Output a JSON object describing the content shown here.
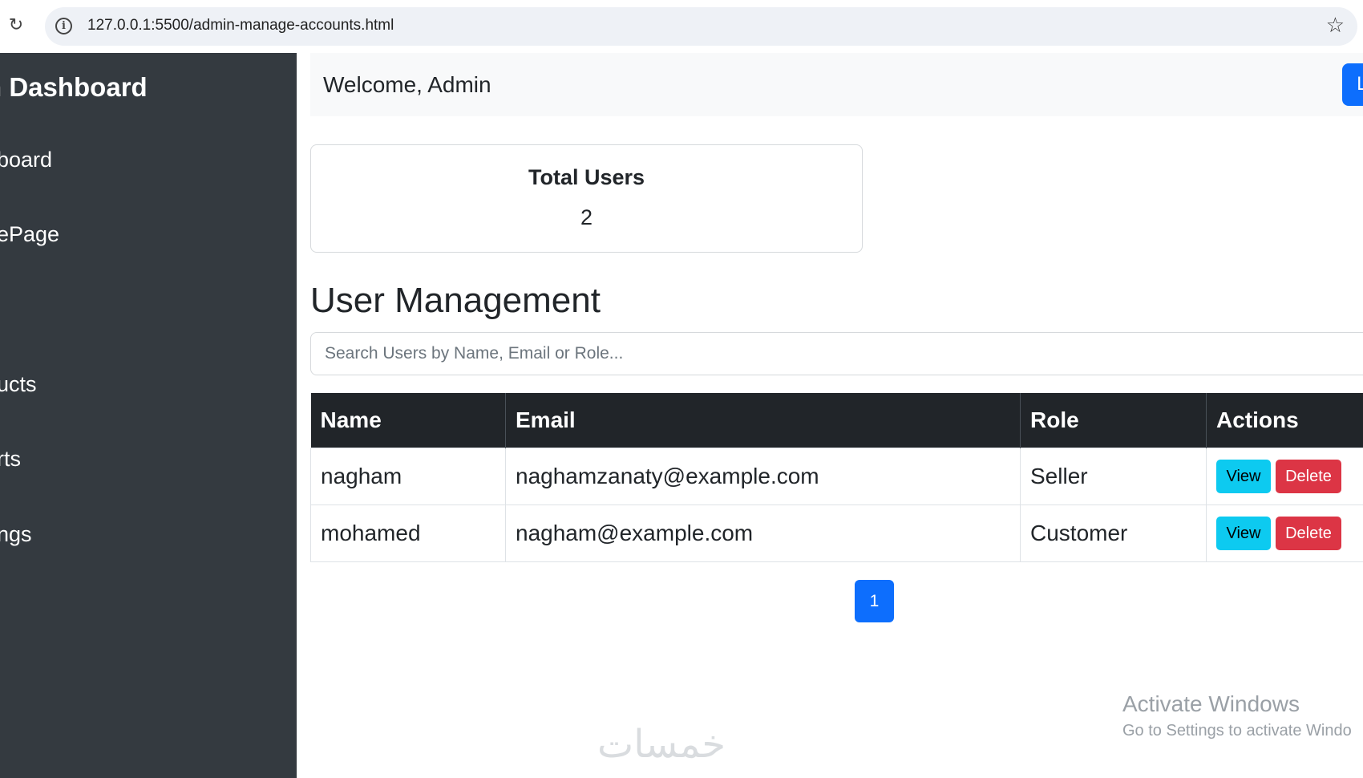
{
  "browser": {
    "url": "127.0.0.1:5500/admin-manage-accounts.html"
  },
  "sidebar": {
    "title": "n Dashboard",
    "items": [
      {
        "label": "board"
      },
      {
        "label": "ePage"
      },
      {
        "label": "ucts"
      },
      {
        "label": "rts"
      },
      {
        "label": "ngs"
      }
    ]
  },
  "topbar": {
    "welcome": "Welcome, Admin",
    "logout_label": "L"
  },
  "stats": {
    "title": "Total Users",
    "value": "2"
  },
  "user_management": {
    "title": "User Management",
    "search_placeholder": "Search Users by Name, Email or Role..."
  },
  "table": {
    "headers": [
      "Name",
      "Email",
      "Role",
      "Actions"
    ],
    "rows": [
      {
        "name": "nagham",
        "email": "naghamzanaty@example.com",
        "role": "Seller",
        "view": "View",
        "delete": "Delete"
      },
      {
        "name": "mohamed",
        "email": "nagham@example.com",
        "role": "Customer",
        "view": "View",
        "delete": "Delete"
      }
    ]
  },
  "pagination": {
    "current": "1"
  },
  "os_overlay": {
    "title": "Activate Windows",
    "subtitle": "Go to Settings to activate Windo"
  },
  "watermark": "خمسات",
  "icons": {
    "reload": "reload-icon",
    "info": "info-icon",
    "star": "star-icon"
  },
  "colors": {
    "sidebar": "#343a40",
    "primary": "#0d6efd",
    "info": "#0dcaf0",
    "danger": "#dc3545",
    "table_header": "#212529"
  }
}
